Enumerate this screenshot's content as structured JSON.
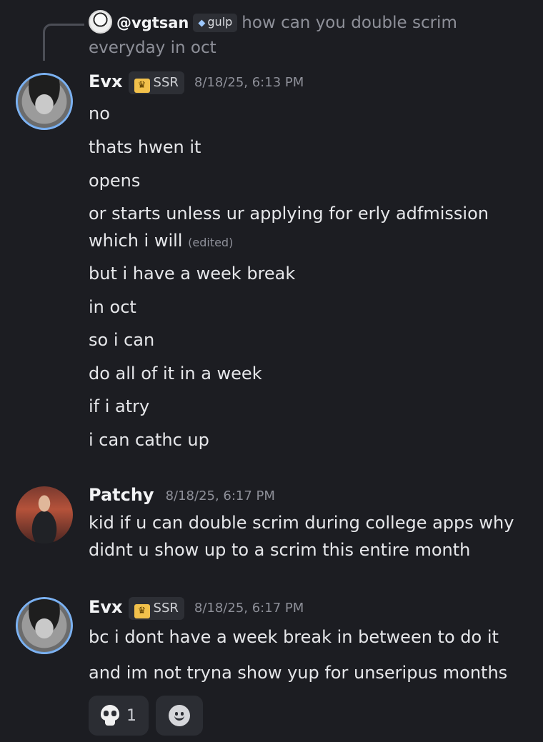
{
  "reply": {
    "username": "@vgtsan",
    "tag": "gulp",
    "text_part1": "how can you double scrim",
    "text_part2": "everyday in oct"
  },
  "messages": [
    {
      "author": "Evx",
      "badge": "SSR",
      "timestamp": "8/18/25, 6:13 PM",
      "lines": [
        "no",
        "thats hwen it",
        "opens",
        "or starts unless ur applying for erly adfmission",
        "which i will",
        "but i have a week break",
        "in oct",
        "so i can",
        "do all of it in a week",
        "if i atry",
        "i can cathc up"
      ],
      "edited_label": "(edited)"
    },
    {
      "author": "Patchy",
      "timestamp": "8/18/25, 6:17 PM",
      "lines": [
        "kid if u can double scrim during college apps why",
        "didnt u show up to a scrim this entire month"
      ]
    },
    {
      "author": "Evx",
      "badge": "SSR",
      "timestamp": "8/18/25, 6:17 PM",
      "lines": [
        "bc i dont have a week break in between to do it",
        "and im not tryna show yup for unseripus months"
      ]
    }
  ],
  "reactions": [
    {
      "icon": "skull-icon",
      "count": "1"
    },
    {
      "icon": "add-reaction-icon"
    }
  ]
}
